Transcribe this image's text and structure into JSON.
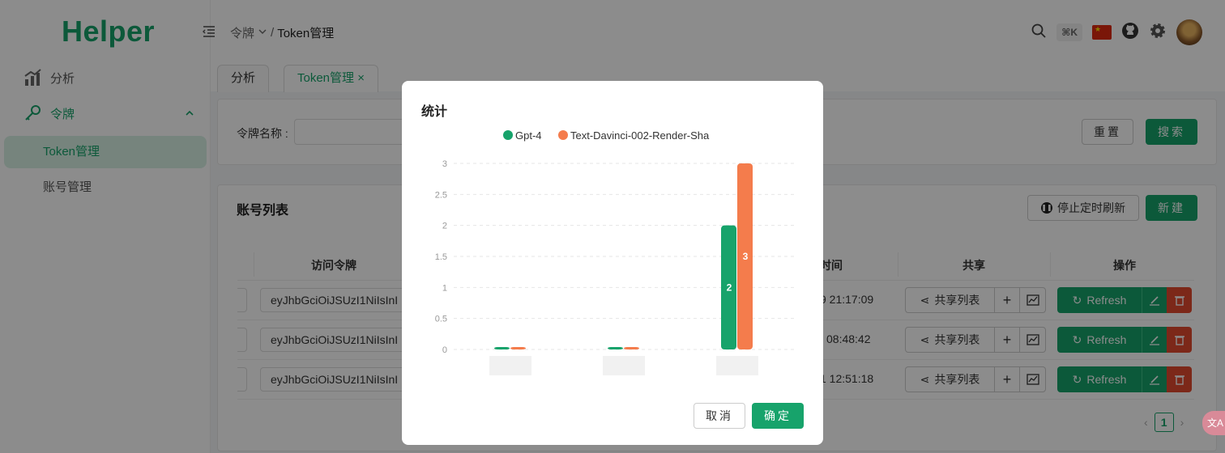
{
  "app": {
    "logo": "Helper"
  },
  "sidebar": {
    "items": [
      {
        "label": "分析"
      },
      {
        "label": "令牌"
      }
    ],
    "sub_items": [
      {
        "label": "Token管理"
      },
      {
        "label": "账号管理"
      }
    ]
  },
  "breadcrumb": {
    "parent": "令牌",
    "separator": "/",
    "current": "Token管理"
  },
  "header": {
    "shortcut": "⌘K"
  },
  "tabs": [
    {
      "label": "分析"
    },
    {
      "label": "Token管理",
      "close": "×"
    }
  ],
  "search": {
    "label": "令牌名称 :",
    "value": "",
    "reset_label": "重置",
    "search_label": "搜索"
  },
  "list": {
    "title": "账号列表",
    "stop_refresh_label": "停止定时刷新",
    "new_label": "新建",
    "columns": [
      "访问令牌",
      "时间",
      "共享",
      "操作"
    ],
    "rows": [
      {
        "token": "eyJhbGciOiJSUzI1NiIsInI",
        "time": "9 21:17:09",
        "share_label": "共享列表",
        "refresh_label": "Refresh"
      },
      {
        "token": "eyJhbGciOiJSUzI1NiIsInI",
        "time": "08:48:42",
        "share_label": "共享列表",
        "refresh_label": "Refresh"
      },
      {
        "token": "eyJhbGciOiJSUzI1NiIsInI",
        "time": "1 12:51:18",
        "share_label": "共享列表",
        "refresh_label": "Refresh"
      }
    ],
    "pagination": {
      "current": "1"
    }
  },
  "modal": {
    "title": "统计",
    "cancel_label": "取消",
    "ok_label": "确定"
  },
  "chart_data": {
    "type": "bar",
    "title": "",
    "categories": [
      "",
      "",
      ""
    ],
    "series": [
      {
        "name": "Gpt-4",
        "color": "#17a36b",
        "values": [
          0,
          0,
          2
        ]
      },
      {
        "name": "Text-Davinci-002-Render-Sha",
        "color": "#f47c4c",
        "values": [
          0,
          0,
          3
        ]
      }
    ],
    "ylim": [
      0,
      3
    ],
    "yticks": [
      "0",
      "0.5",
      "1",
      "1.5",
      "2",
      "2.5",
      "3"
    ],
    "data_labels": [
      "2",
      "3"
    ],
    "legend": "top",
    "grid": true
  },
  "colors": {
    "primary": "#17a36b",
    "danger": "#e24a2e",
    "series2": "#f47c4c"
  }
}
